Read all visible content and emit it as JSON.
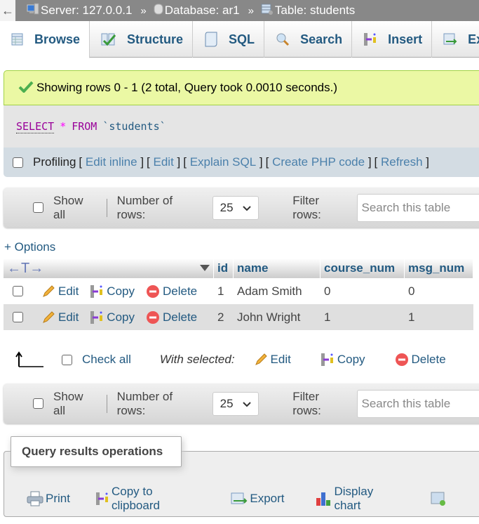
{
  "breadcrumb": {
    "back_icon": "arrow-left",
    "server": "Server: 127.0.0.1",
    "database": "Database: ar1",
    "table": "Table: students",
    "separator": "»"
  },
  "tabs": [
    {
      "label": "Browse",
      "icon": "table-icon",
      "active": true
    },
    {
      "label": "Structure",
      "icon": "structure-icon"
    },
    {
      "label": "SQL",
      "icon": "sql-icon"
    },
    {
      "label": "Search",
      "icon": "search-icon"
    },
    {
      "label": "Insert",
      "icon": "insert-icon"
    },
    {
      "label": "Export",
      "icon": "export-icon"
    }
  ],
  "message": {
    "text": "Showing rows 0 - 1 (2 total, Query took 0.0010 seconds.)"
  },
  "sql": {
    "select": "SELECT",
    "star": "*",
    "from": "FROM",
    "table": "`students`"
  },
  "profiling": {
    "label": "Profiling",
    "links": [
      "Edit inline",
      "Edit",
      "Explain SQL",
      "Create PHP code",
      "Refresh"
    ]
  },
  "navbar": {
    "show_all": "Show all",
    "rows_label": "Number of rows:",
    "rows_value": "25",
    "filter_label": "Filter rows:",
    "search_placeholder": "Search this table"
  },
  "options_link": "+ Options",
  "table": {
    "sort_arrows": "←T→",
    "columns": [
      "id",
      "name",
      "course_num",
      "msg_num"
    ],
    "actions": {
      "edit": "Edit",
      "copy": "Copy",
      "delete": "Delete"
    },
    "rows": [
      {
        "id": "1",
        "name": "Adam Smith",
        "course_num": "0",
        "msg_num": "0"
      },
      {
        "id": "2",
        "name": "John Wright",
        "course_num": "1",
        "msg_num": "1"
      }
    ]
  },
  "with_selected": {
    "check_all": "Check all",
    "label": "With selected:",
    "edit": "Edit",
    "copy": "Copy",
    "delete": "Delete"
  },
  "operations": {
    "title": "Query results operations",
    "items": [
      "Print",
      "Copy to clipboard",
      "Export",
      "Display chart"
    ]
  }
}
